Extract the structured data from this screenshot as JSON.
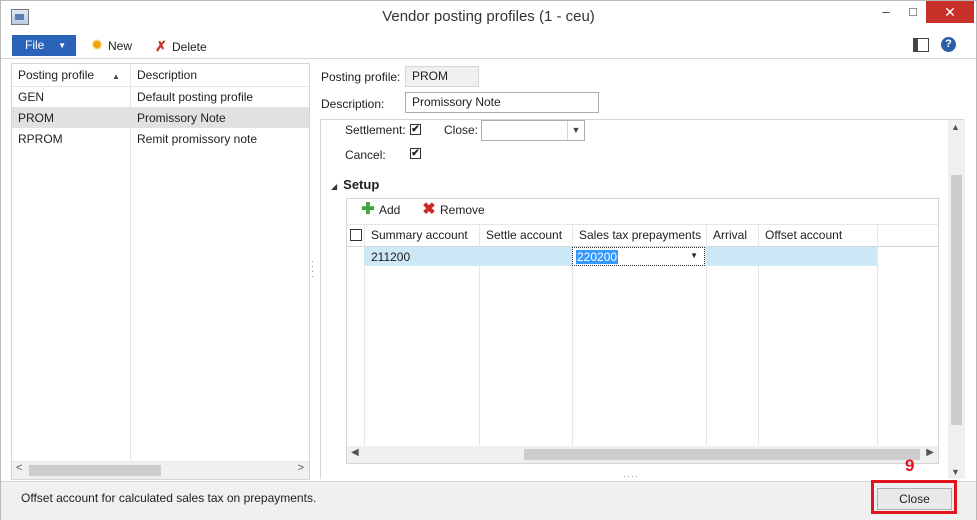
{
  "window": {
    "title": "Vendor posting profiles (1 - ceu)",
    "controls": {
      "minimize": "–",
      "maximize": "□",
      "close": "✕"
    }
  },
  "ribbon": {
    "file_label": "File",
    "file_arrow": "▼",
    "new_label": "New",
    "delete_label": "Delete",
    "icons": {
      "new": "sun-star-icon",
      "delete": "red-x-icon",
      "layout": "layout-panel-icon",
      "help": "help-icon"
    },
    "help_glyph": "?"
  },
  "left_grid": {
    "headers": [
      "Posting profile",
      "Description"
    ],
    "sort_indicator": "▲",
    "rows": [
      {
        "profile": "GEN",
        "description": "Default posting profile"
      },
      {
        "profile": "PROM",
        "description": "Promissory Note"
      },
      {
        "profile": "RPROM",
        "description": "Remit promissory note"
      }
    ],
    "selected_index": 1
  },
  "header_fields": {
    "posting_profile_label": "Posting profile:",
    "posting_profile_value": "PROM",
    "description_label": "Description:",
    "description_value": "Promissory Note"
  },
  "options": {
    "settlement_label": "Settlement:",
    "settlement_checked": true,
    "close_label": "Close:",
    "close_value": "",
    "cancel_label": "Cancel:",
    "cancel_checked": true,
    "check_glyph": "✔"
  },
  "setup": {
    "heading": "Setup",
    "collapse_glyph": "◢",
    "add_label": "Add",
    "remove_label": "Remove",
    "columns": [
      "Summary account",
      "Settle account",
      "Sales tax prepayments",
      "Arrival",
      "Offset account"
    ],
    "rows": [
      {
        "summary_account": "211200",
        "settle_account": "",
        "sales_tax_prepayments": "220200",
        "arrival": "",
        "offset_account": ""
      }
    ]
  },
  "status": {
    "text": "Offset account for calculated sales tax on prepayments.",
    "close_button": "Close"
  },
  "annotation": {
    "number": "9",
    "color": "#e0141e"
  },
  "colors": {
    "file_button": "#2b63bb",
    "selected_row": "#cde8f6",
    "close_control": "#c7312a"
  }
}
